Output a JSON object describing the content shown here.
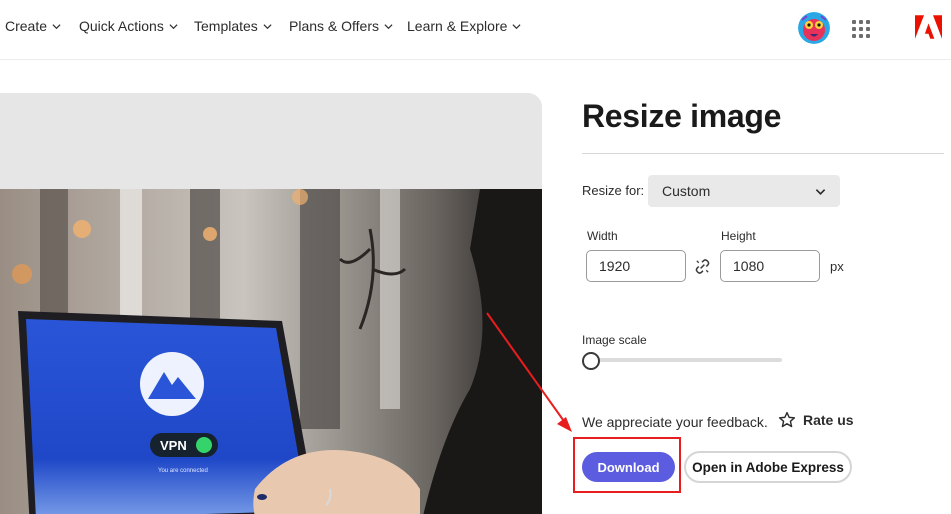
{
  "nav": {
    "items": [
      {
        "label": "Create"
      },
      {
        "label": "Quick Actions"
      },
      {
        "label": "Templates"
      },
      {
        "label": "Plans & Offers"
      },
      {
        "label": "Learn & Explore"
      }
    ]
  },
  "preview": {
    "vpn_badge": "VPN",
    "vpn_status": "You are connected"
  },
  "panel": {
    "title": "Resize image",
    "resize_for_label": "Resize for:",
    "resize_for_value": "Custom",
    "width_label": "Width",
    "width_value": "1920",
    "height_label": "Height",
    "height_value": "1080",
    "unit": "px",
    "scale_label": "Image scale",
    "scale_value": 0,
    "feedback_text": "We appreciate your feedback.",
    "rate_label": "Rate us",
    "download_label": "Download",
    "express_label": "Open in Adobe Express"
  },
  "colors": {
    "download_bg": "#5c5ce0",
    "annotation_red": "#e81d1d",
    "adobe_red": "#eb1000"
  }
}
